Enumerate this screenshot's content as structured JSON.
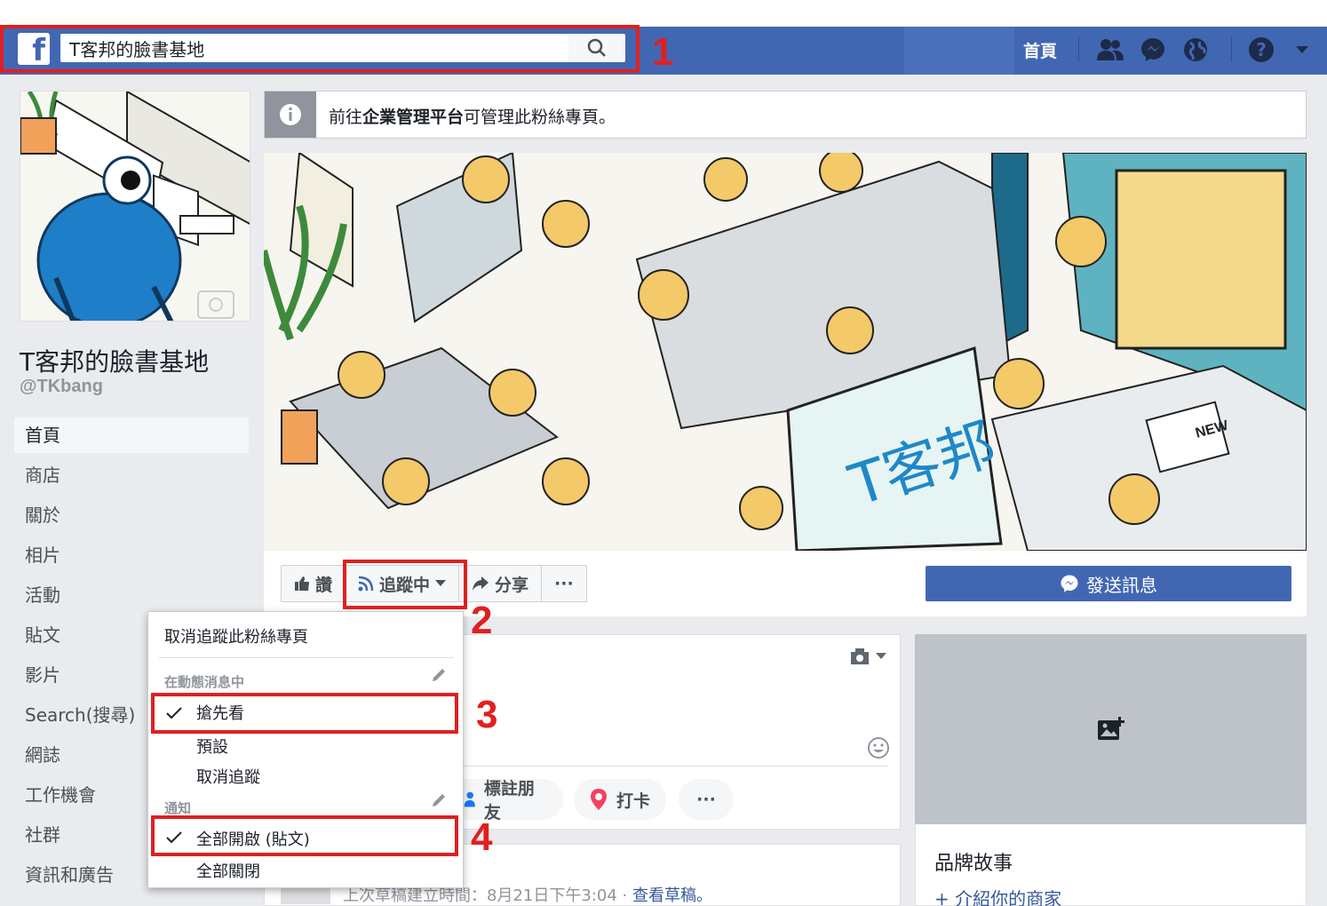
{
  "header": {
    "search_value": "T客邦的臉書基地",
    "nav_home": "首頁",
    "icons": [
      "friends-icon",
      "messenger-icon",
      "globe-icon",
      "help-icon",
      "chevron-down-icon"
    ]
  },
  "annotations": [
    "1",
    "2",
    "3",
    "4"
  ],
  "page": {
    "name": "T客邦的臉書基地",
    "handle": "@TKbang"
  },
  "left_nav": [
    "首頁",
    "商店",
    "關於",
    "相片",
    "活動",
    "貼文",
    "影片",
    "Search(搜尋)",
    "網誌",
    "工作機會",
    "社群",
    "資訊和廣告"
  ],
  "banner": {
    "prefix": "前往",
    "bold": "企業管理平台",
    "suffix": "可管理此粉絲專頁。"
  },
  "cover_text": "T客邦",
  "cover_badge": "NEW",
  "actions": {
    "like": "讚",
    "following": "追蹤中",
    "share": "分享",
    "more": "···",
    "send_message": "發送訊息"
  },
  "dropdown": {
    "unfollow_page": "取消追蹤此粉絲專頁",
    "section_feed": "在動態消息中",
    "see_first": "搶先看",
    "default": "預設",
    "unfollow": "取消追蹤",
    "section_notify": "通知",
    "all_on": "全部開啟 (貼文)",
    "all_off": "全部關閉"
  },
  "composer": {
    "tag_friends": "標註朋友",
    "check_in": "打卡",
    "more": "···"
  },
  "draft": {
    "text": "上次草稿建立時間：8月21日下午3:04 ·",
    "link": "查看草稿。"
  },
  "right_card": {
    "title": "品牌故事",
    "link": "+ 介紹你的商家"
  },
  "colors": {
    "facebook_blue": "#4267b2",
    "annotation_red": "#e02020"
  }
}
